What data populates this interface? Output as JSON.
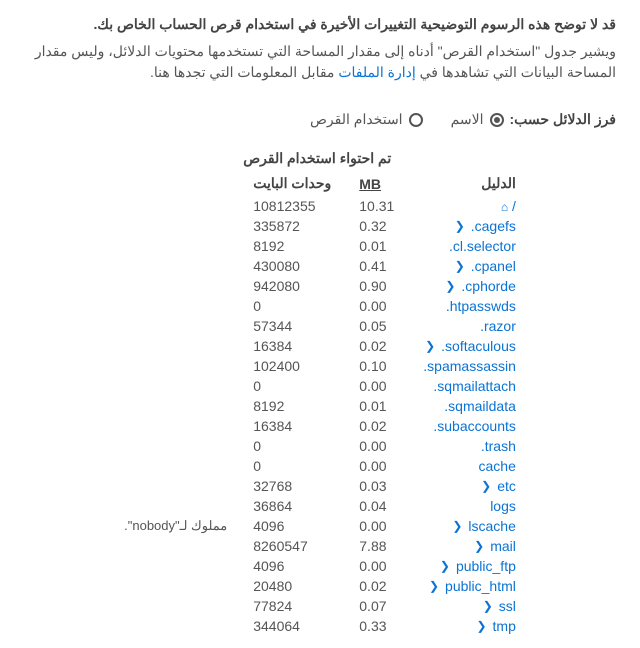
{
  "intro": {
    "bold": "قد لا توضح هذه الرسوم التوضيحية التغييرات الأخيرة في استخدام قرص الحساب الخاص بك.",
    "para_before": "ويشير جدول \"استخدام القرص\" أدناه إلى مقدار المساحة التي تستخدمها محتويات الدلائل، وليس مقدار المساحة البيانات التي تشاهدها في ",
    "link": "إدارة الملفات",
    "para_after": " مقابل المعلومات التي تجدها هنا."
  },
  "sort": {
    "label": "فرز الدلائل حسب:",
    "name": "الاسم",
    "disk": "استخدام القرص"
  },
  "table": {
    "dir_header": "الدليل",
    "contained_header": "تم احتواء استخدام القرص",
    "mb_header": "MB",
    "bytes_header": "وحدات البايت",
    "home_label": "/",
    "rows": [
      {
        "name": "/",
        "mb": "10.31",
        "bytes": "10812355",
        "arrow": false,
        "home": true
      },
      {
        "name": ".cagefs",
        "mb": "0.32",
        "bytes": "335872",
        "arrow": true
      },
      {
        "name": ".cl.selector",
        "mb": "0.01",
        "bytes": "8192",
        "arrow": false
      },
      {
        "name": ".cpanel",
        "mb": "0.41",
        "bytes": "430080",
        "arrow": true
      },
      {
        "name": ".cphorde",
        "mb": "0.90",
        "bytes": "942080",
        "arrow": true
      },
      {
        "name": ".htpasswds",
        "mb": "0.00",
        "bytes": "0",
        "arrow": false
      },
      {
        "name": ".razor",
        "mb": "0.05",
        "bytes": "57344",
        "arrow": false
      },
      {
        "name": ".softaculous",
        "mb": "0.02",
        "bytes": "16384",
        "arrow": true
      },
      {
        "name": ".spamassassin",
        "mb": "0.10",
        "bytes": "102400",
        "arrow": false
      },
      {
        "name": ".sqmailattach",
        "mb": "0.00",
        "bytes": "0",
        "arrow": false
      },
      {
        "name": ".sqmaildata",
        "mb": "0.01",
        "bytes": "8192",
        "arrow": false
      },
      {
        "name": ".subaccounts",
        "mb": "0.02",
        "bytes": "16384",
        "arrow": false
      },
      {
        "name": ".trash",
        "mb": "0.00",
        "bytes": "0",
        "arrow": false
      },
      {
        "name": "cache",
        "mb": "0.00",
        "bytes": "0",
        "arrow": false
      },
      {
        "name": "etc",
        "mb": "0.03",
        "bytes": "32768",
        "arrow": true
      },
      {
        "name": "logs",
        "mb": "0.04",
        "bytes": "36864",
        "arrow": false
      },
      {
        "name": "lscache",
        "mb": "0.00",
        "bytes": "4096",
        "arrow": true,
        "note": "مملوك لـ\"nobody\"."
      },
      {
        "name": "mail",
        "mb": "7.88",
        "bytes": "8260547",
        "arrow": true
      },
      {
        "name": "public_ftp",
        "mb": "0.00",
        "bytes": "4096",
        "arrow": true
      },
      {
        "name": "public_html",
        "mb": "0.02",
        "bytes": "20480",
        "arrow": true
      },
      {
        "name": "ssl",
        "mb": "0.07",
        "bytes": "77824",
        "arrow": true
      },
      {
        "name": "tmp",
        "mb": "0.33",
        "bytes": "344064",
        "arrow": true
      }
    ]
  }
}
